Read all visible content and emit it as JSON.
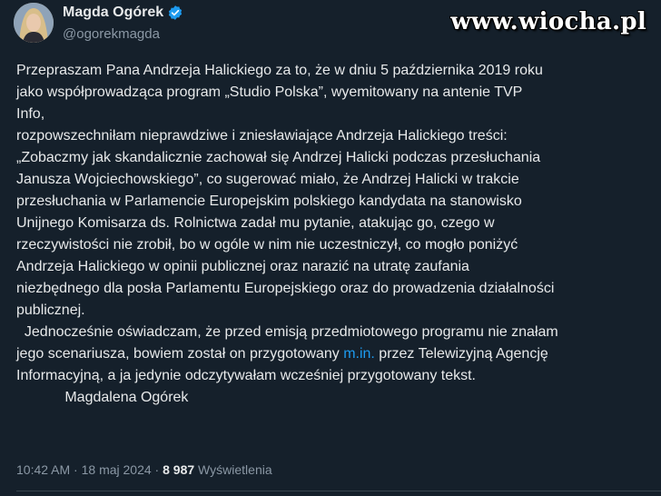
{
  "author": {
    "display_name": "Magda Ogórek",
    "handle": "@ogorekmagda",
    "verified_icon": "verified-badge-icon",
    "verified_color": "#1d9bf0"
  },
  "watermark": "www.wiocha.pl",
  "post": {
    "lines": [
      "Przepraszam Pana Andrzeja Halickiego za to, że w dniu 5 października 2019 roku",
      "jako współprowadząca program „Studio Polska”, wyemitowany na antenie TVP",
      "Info,",
      "rozpowszechniłam nieprawdziwe i zniesławiające Andrzeja Halickiego treści:",
      "„Zobaczmy jak skandalicznie zachował się Andrzej Halicki podczas przesłuchania",
      "Janusza Wojciechowskiego”, co sugerować miało, że Andrzej Halicki w trakcie",
      "przesłuchania w Parlamencie Europejskim polskiego kandydata na stanowisko",
      "Unijnego Komisarza ds. Rolnictwa zadał mu pytanie, atakując go, czego w",
      "rzeczywistości nie zrobił, bo w ogóle w nim nie uczestniczył, co mogło poniżyć",
      "Andrzeja Halickiego w opinii publicznej oraz narazić na utratę zaufania",
      "niezbędnego dla posła Parlamentu Europejskiego oraz do prowadzenia działalności",
      "publicznej."
    ],
    "line13_before": "  Jednocześnie oświadczam, że przed emisją przedmiotowego programu nie znałam",
    "line14_before": "jego scenariusza, bowiem został on przygotowany ",
    "line14_link": "m.in.",
    "line14_after": " przez Telewizyjną Agencję",
    "line15": "Informacyjną, a ja jedynie odczytywałam wcześniej przygotowany tekst.",
    "signature": "            Magdalena Ogórek",
    "link_color": "#1d9bf0"
  },
  "meta": {
    "time": "10:42 AM",
    "sep1": " · ",
    "date": "18 maj 2024",
    "sep2": " · ",
    "views_count": "8 987",
    "views_label": " Wyświetlenia"
  }
}
